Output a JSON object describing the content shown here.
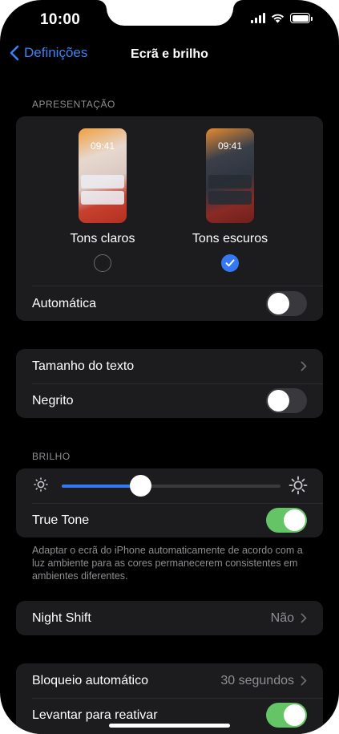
{
  "status_bar": {
    "time": "10:00"
  },
  "navbar": {
    "back_label": "Definições",
    "title": "Ecrã e brilho"
  },
  "appearance": {
    "section_label": "APRESENTAÇÃO",
    "light": {
      "label": "Tons claros",
      "preview_time": "09:41",
      "selected": false
    },
    "dark": {
      "label": "Tons escuros",
      "preview_time": "09:41",
      "selected": true
    },
    "automatic": {
      "label": "Automática",
      "on": false
    }
  },
  "text": {
    "size_label": "Tamanho do texto",
    "bold": {
      "label": "Negrito",
      "on": false
    }
  },
  "brightness": {
    "section_label": "BRILHO",
    "level": 0.36,
    "true_tone": {
      "label": "True Tone",
      "on": true
    },
    "footnote": "Adaptar o ecrã do iPhone automaticamente de acordo com a luz ambiente para as cores permanecerem consistentes em ambientes diferentes."
  },
  "night_shift": {
    "label": "Night Shift",
    "value": "Não"
  },
  "lock": {
    "auto_lock": {
      "label": "Bloqueio automático",
      "value": "30 segundos"
    },
    "raise_to_wake": {
      "label": "Levantar para reativar",
      "on": true
    }
  },
  "colors": {
    "accent": "#3478f6",
    "toggle_on": "#65c466",
    "cell": "#1c1c1e",
    "secondary_text": "#8e8e93"
  }
}
